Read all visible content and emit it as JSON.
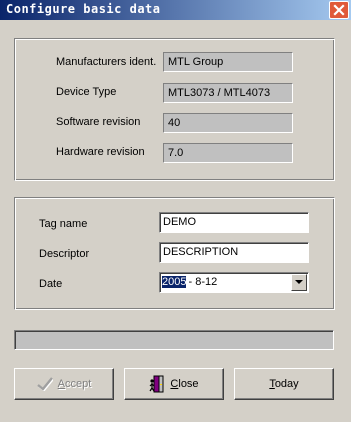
{
  "window": {
    "title": "Configure basic data"
  },
  "info": {
    "manufacturer_label": "Manufacturers ident.",
    "manufacturer_value": "MTL Group",
    "device_type_label": "Device Type",
    "device_type_value": "MTL3073 / MTL4073",
    "software_label": "Software revision",
    "software_value": "40",
    "hardware_label": "Hardware revision",
    "hardware_value": "7.0"
  },
  "form": {
    "tag_label": "Tag name",
    "tag_value": "DEMO",
    "descriptor_label": "Descriptor",
    "descriptor_value": "DESCRIPTION",
    "date_label": "Date",
    "date_year": "2005",
    "date_rest": "- 8-12"
  },
  "progress": {
    "fraction": 0
  },
  "buttons": {
    "accept_first": "A",
    "accept_rest": "ccept",
    "close_first": "C",
    "close_rest": "lose",
    "today_first": "T",
    "today_rest": "oday"
  },
  "icons": {
    "close": "close-x-icon",
    "accept": "checkmark-icon",
    "close_button": "door-exit-icon",
    "dropdown": "triangle-down-icon"
  },
  "colors": {
    "titlebar_start": "#0a246a",
    "titlebar_end": "#a6caf0",
    "window_bg": "#d4d0c8",
    "selection": "#0a246a"
  }
}
